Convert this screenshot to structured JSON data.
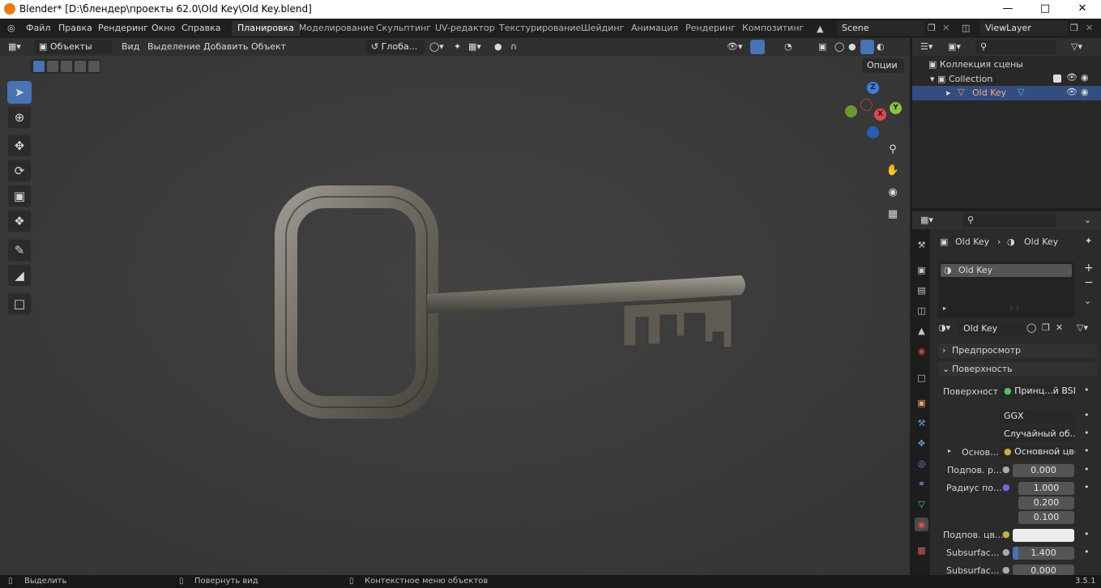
{
  "title": "Blender* [D:\\блендер\\проекты 62.0\\Old Key\\Old Key.blend]",
  "menu": [
    "Файл",
    "Правка",
    "Рендеринг",
    "Окно",
    "Справка"
  ],
  "workspaces": [
    "Планировка",
    "Моделирование",
    "Скульптинг",
    "UV-редактор",
    "Текстурирование",
    "Шейдинг",
    "Анимация",
    "Рендеринг",
    "Композитинг"
  ],
  "active_workspace": "Планировка",
  "scene": "Scene",
  "view_layer": "ViewLayer",
  "viewport": {
    "mode": "Объекты",
    "menus": [
      "Вид",
      "Выделение",
      "Добавить",
      "Объект"
    ],
    "transform": "Глоба...",
    "options": "Опции",
    "axes": {
      "z": "Z",
      "y": "Y",
      "x": "X"
    }
  },
  "outliner": {
    "scene_collection": "Коллекция сцены",
    "collection": "Collection",
    "object": "Old Key"
  },
  "properties": {
    "breadcrumb_object": "Old Key",
    "breadcrumb_material": "Old Key",
    "slot": "Old Key",
    "material_name": "Old Key",
    "preview": "Предпросмотр",
    "surface_panel": "Поверхность",
    "surface_label": "Поверхность",
    "surface_value": "Принц...й BSDF",
    "distribution": "GGX",
    "subsurface_method": "Случайный об...",
    "base_label": "Основ...",
    "base_value": "Основной цвет",
    "subsurf_label": "Подпов. р...",
    "subsurf_value": "0.000",
    "radius_label": "Радиус по...",
    "radius_values": [
      "1.000",
      "0.200",
      "0.100"
    ],
    "subsurf_color_label": "Подпов. цв...",
    "subsurface_ior_label": "Subsurfac...",
    "subsurface_ior": "1.400",
    "subsurface_aniso_label": "Subsurfac...",
    "subsurface_aniso": "0.000"
  },
  "status": {
    "select": "Выделить",
    "rotate": "Повернуть вид",
    "context": "Контекстное меню объектов",
    "version": "3.5.1"
  },
  "colors": {
    "accent": "#4772b3",
    "x_axis": "#e14a4a",
    "y_axis": "#8ac53d",
    "z_axis": "#3d7ee0"
  }
}
